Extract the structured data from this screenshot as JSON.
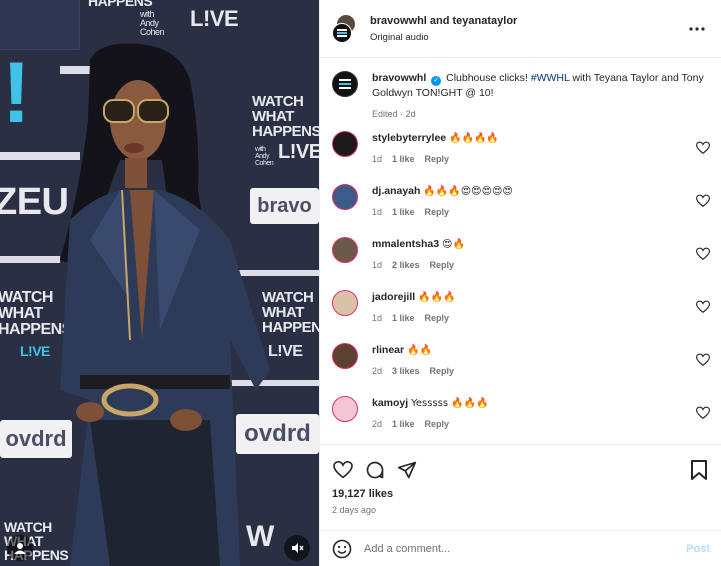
{
  "post": {
    "header_users": "bravowwhl and teyanataylor",
    "audio": "Original audio",
    "more_icon": "more-horizontal-icon"
  },
  "caption": {
    "user": "bravowwhl",
    "text_before": "Clubhouse clicks! ",
    "hashtag": "#WWHL",
    "text_after": " with Teyana Taylor and Tony Goldwyn TON!GHT @ 10!",
    "edited": "Edited",
    "time": "2d"
  },
  "comments": [
    {
      "user": "stylebyterrylee",
      "text": "🔥🔥🔥🔥",
      "time": "1d",
      "likes": "1 like",
      "reply": "Reply",
      "avatar_color": "#1a1a1a"
    },
    {
      "user": "dj.anayah",
      "text": "🔥🔥🔥😍😍😍😍😍",
      "time": "1d",
      "likes": "1 like",
      "reply": "Reply",
      "avatar_color": "#3c5a8a"
    },
    {
      "user": "mmalentsha3",
      "text": "😍🔥",
      "time": "1d",
      "likes": "2 likes",
      "reply": "Reply",
      "avatar_color": "#6b5a4c"
    },
    {
      "user": "jadorejill",
      "text": "🔥🔥🔥",
      "time": "1d",
      "likes": "1 like",
      "reply": "Reply",
      "avatar_color": "#d9c2a8"
    },
    {
      "user": "rlinear",
      "text": "🔥🔥",
      "time": "2d",
      "likes": "3 likes",
      "reply": "Reply",
      "avatar_color": "#5c4030"
    },
    {
      "user": "kamoyj",
      "text": "Yesssss 🔥🔥🔥",
      "time": "2d",
      "likes": "1 like",
      "reply": "Reply",
      "avatar_color": "#f2c6d4"
    }
  ],
  "actions": {
    "likes": "19,127 likes",
    "ago": "2 days ago"
  },
  "composer": {
    "placeholder": "Add a comment...",
    "post_label": "Post"
  },
  "media": {
    "wall": {
      "watch1": "WATCH\nWHAT\nHAPPENS",
      "with": "with\nAndy\nCohen",
      "live": "L!VE",
      "bravo": "bravo",
      "bang": "!",
      "zeu": "ZEU",
      "happens_top": "HAPPENS",
      "ovdrd": "ovdrd",
      "w": "W"
    }
  },
  "colors": {
    "link": "#00376b",
    "verified": "#0095f6",
    "post_disabled": "#b2dffc",
    "muted": "#737373",
    "wall": "#2f3552",
    "cyan": "#3fc4e8"
  }
}
